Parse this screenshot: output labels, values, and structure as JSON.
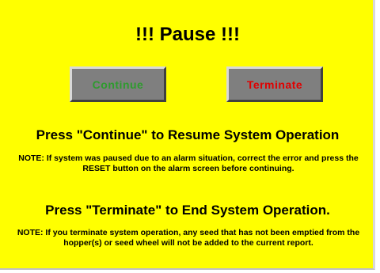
{
  "dialog": {
    "title": "!!! Pause !!!"
  },
  "buttons": {
    "continue_label": "Continue",
    "terminate_label": "Terminate"
  },
  "instructions": {
    "resume_heading": "Press \"Continue\" to Resume System Operation",
    "resume_note": "NOTE: If system was paused due to an alarm situation, correct the error and press the RESET button on the alarm screen before continuing.",
    "end_heading": "Press \"Terminate\" to End System Operation.",
    "end_note": "NOTE: If you terminate system operation, any seed that has not been emptied from the hopper(s) or seed wheel will not be added to the current report."
  },
  "colors": {
    "background": "#ffff00",
    "button_face": "#7f7f7f",
    "continue_text": "#2e9b2e",
    "terminate_text": "#e00000"
  }
}
